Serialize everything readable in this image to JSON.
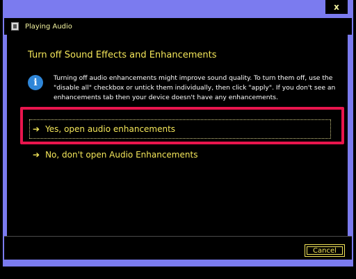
{
  "window": {
    "title": "Playing Audio",
    "close_glyph": "x",
    "icon": "speaker-document-icon",
    "frame_color": "#7b7bef"
  },
  "main": {
    "heading": "Turn off Sound Effects and Enhancements",
    "info_icon": "info-icon",
    "info_text": "Turning off audio enhancements might improve sound quality. To turn them off, use the \"disable all\" checkbox or untick them individually, then click \"apply\". If you don't see an enhancements tab then your device doesn't have any enhancements.",
    "options": [
      {
        "arrow": "➔",
        "label": "Yes, open audio enhancements"
      },
      {
        "arrow": "➔",
        "label": "No, don't open Audio Enhancements"
      }
    ]
  },
  "footer": {
    "cancel_label": "Cancel"
  },
  "colors": {
    "text_accent": "#f5e75a",
    "highlight": "#e8154d",
    "info_icon": "#2f86d8"
  }
}
